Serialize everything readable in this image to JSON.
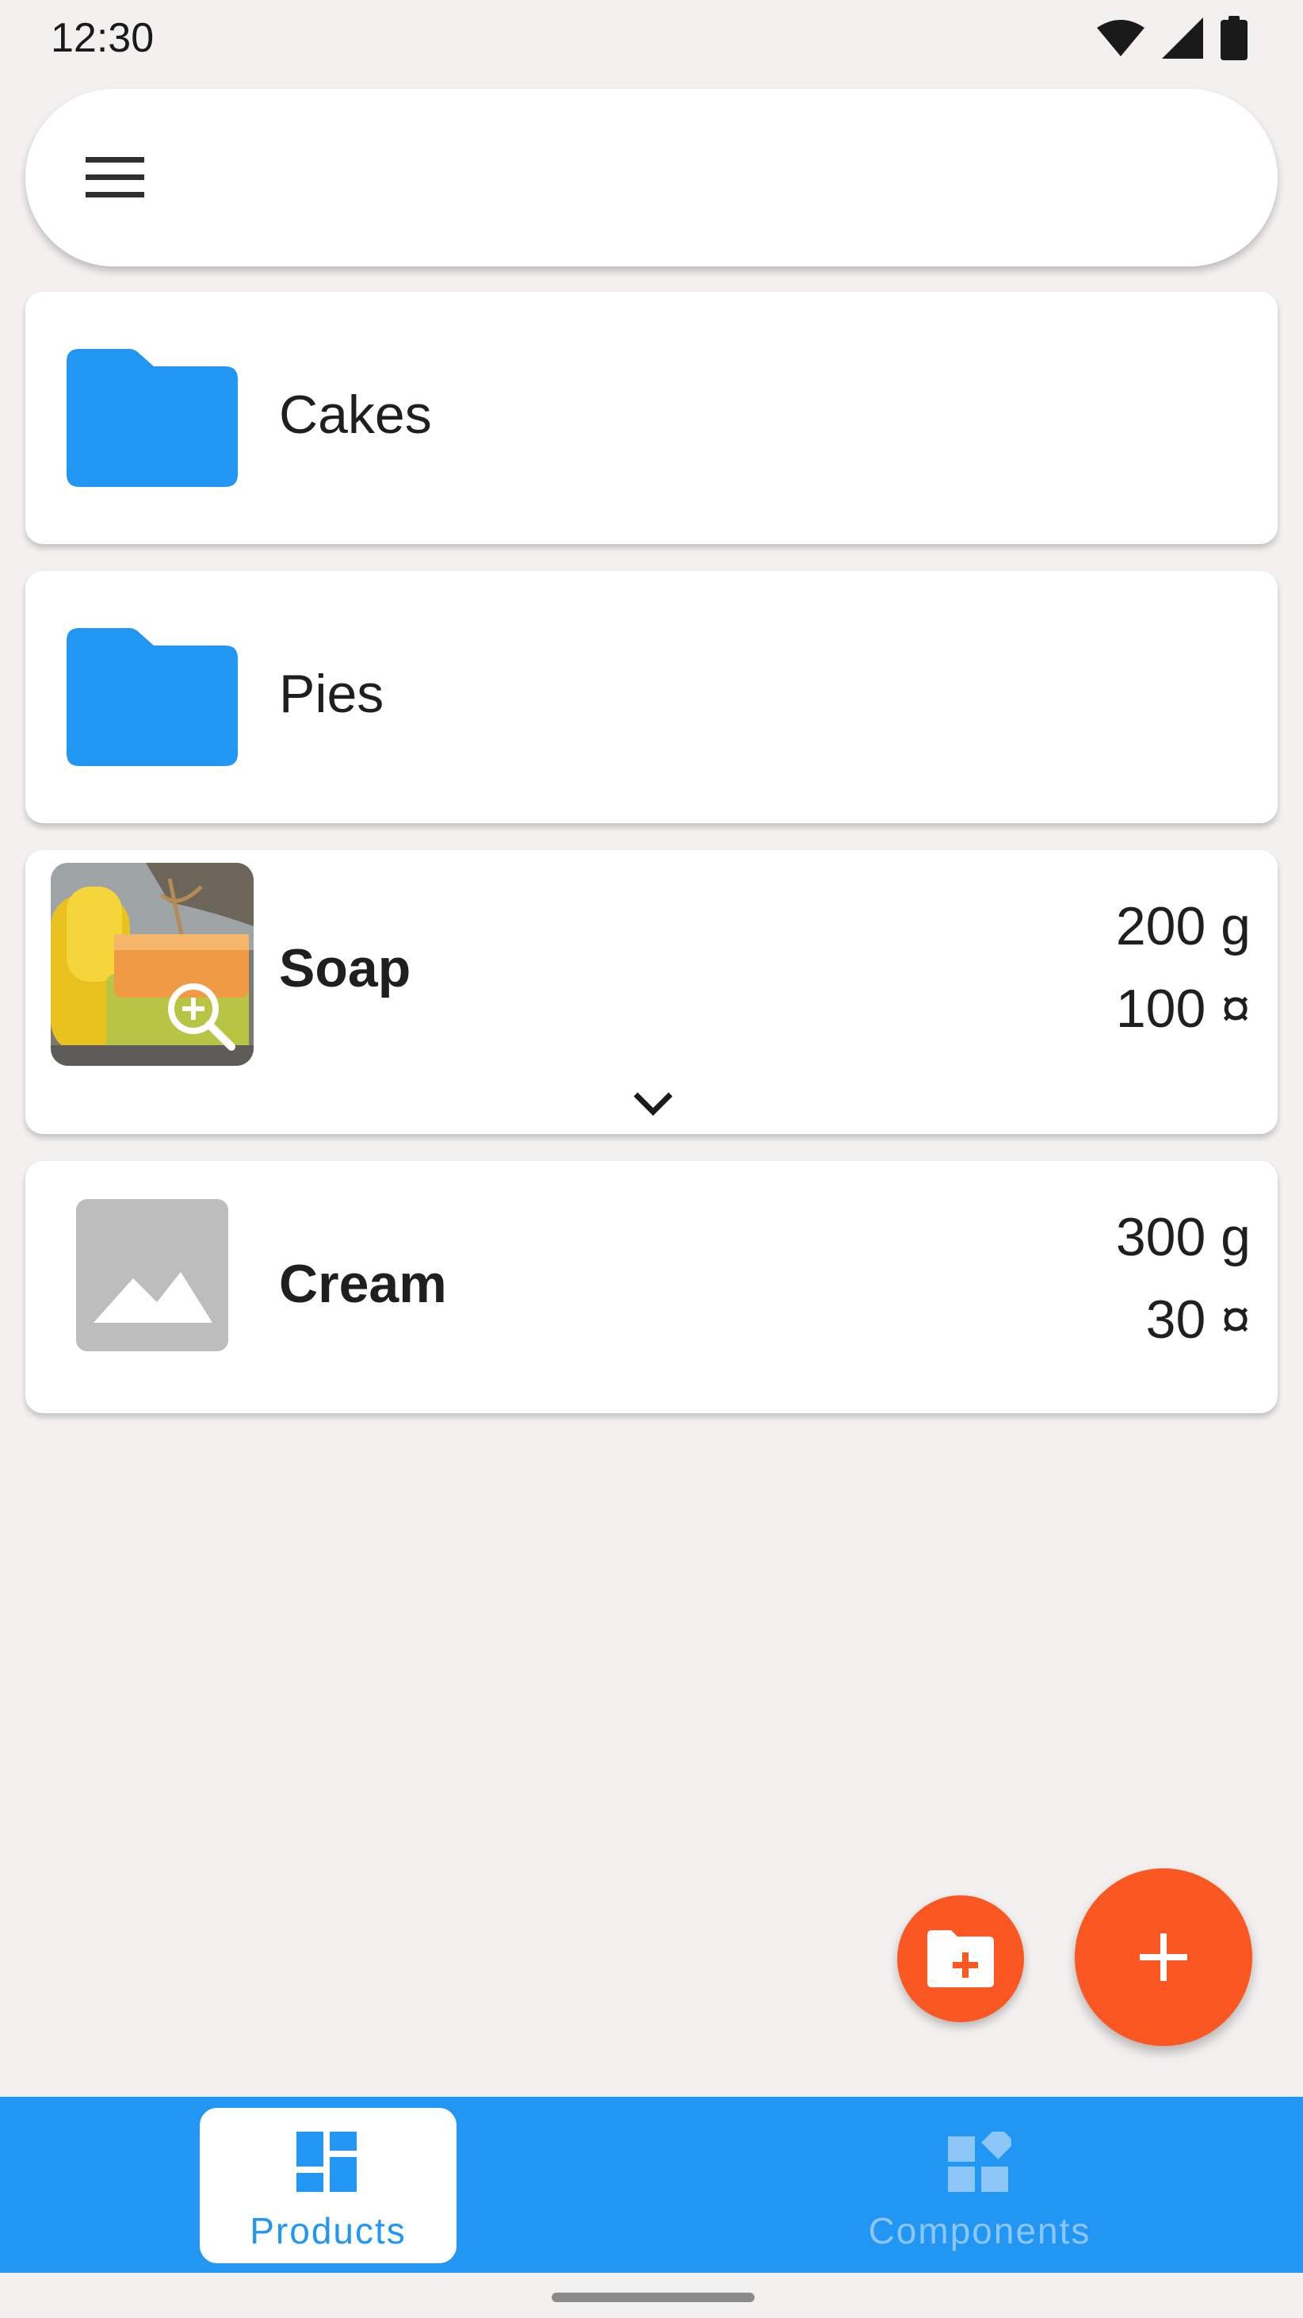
{
  "status_bar": {
    "time": "12:30",
    "icons": [
      "wifi-icon",
      "signal-icon",
      "battery-icon"
    ]
  },
  "top_bar": {
    "menu_icon": "menu-icon"
  },
  "list": {
    "folders": [
      {
        "label": "Cakes",
        "icon": "folder-icon"
      },
      {
        "label": "Pies",
        "icon": "folder-icon"
      }
    ],
    "products": [
      {
        "name": "Soap",
        "weight": "200 g",
        "price": "100 ¤",
        "thumbnail": "soap-photo",
        "expand_icon": "chevron-down-icon"
      },
      {
        "name": "Cream",
        "weight": "300 g",
        "price": "30 ¤",
        "thumbnail": "image-placeholder-icon"
      }
    ]
  },
  "fabs": {
    "add_folder_icon": "create-folder-icon",
    "add_icon": "plus-icon"
  },
  "bottom_nav": {
    "items": [
      {
        "label": "Products",
        "icon": "dashboard-icon",
        "active": true
      },
      {
        "label": "Components",
        "icon": "widgets-icon",
        "active": false
      }
    ]
  },
  "colors": {
    "primary": "#2196f3",
    "accent": "#fb5722",
    "background": "#f3f1f0"
  }
}
